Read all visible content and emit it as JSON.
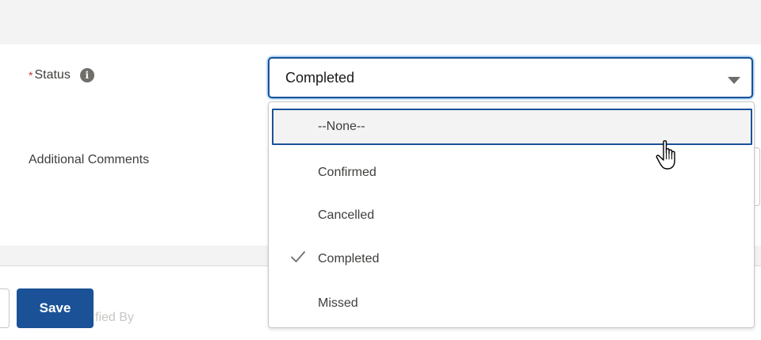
{
  "form": {
    "status_required_marker": "*",
    "status_label": "Status",
    "info_icon": "info-icon",
    "additional_comments_label": "Additional Comments"
  },
  "status_combobox": {
    "selected_value": "Completed",
    "caret_icon": "chevron-down-icon",
    "options": [
      {
        "label": "--None--",
        "focused": true,
        "selected": false
      },
      {
        "label": "Confirmed",
        "focused": false,
        "selected": false
      },
      {
        "label": "Cancelled",
        "focused": false,
        "selected": false
      },
      {
        "label": "Completed",
        "focused": false,
        "selected": true
      },
      {
        "label": "Missed",
        "focused": false,
        "selected": false
      }
    ]
  },
  "footer": {
    "save_label": "Save",
    "obscured_field_text": "fied By"
  },
  "colors": {
    "brand": "#1b5297",
    "required": "#c23934",
    "band": "#f3f3f3"
  }
}
